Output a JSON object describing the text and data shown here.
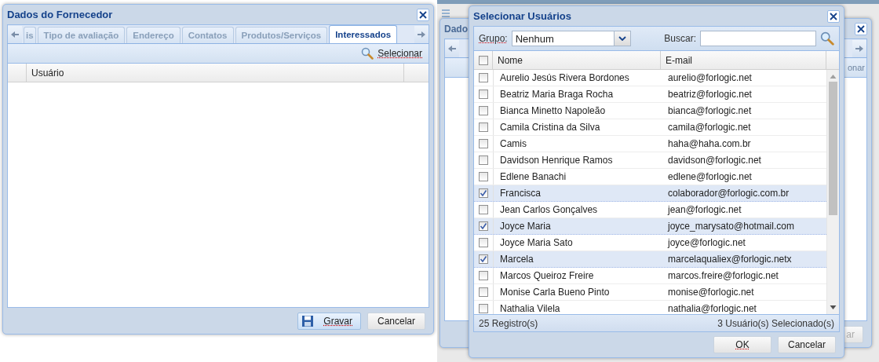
{
  "left_dialog": {
    "title": "Dados do Fornecedor",
    "tabs": [
      {
        "label": "is",
        "selected": false
      },
      {
        "label": "Tipo de avaliação",
        "selected": false
      },
      {
        "label": "Endereço",
        "selected": false
      },
      {
        "label": "Contatos",
        "selected": false
      },
      {
        "label": "Produtos/Serviços",
        "selected": false
      },
      {
        "label": "Interessados",
        "selected": true
      }
    ],
    "select_link": "Selecionar",
    "columns": [
      "Usuário"
    ],
    "buttons": [
      {
        "label": "Gravar",
        "kind": "save"
      },
      {
        "label": "Cancelar",
        "kind": "plain"
      }
    ]
  },
  "background_window": {
    "title": "Dado",
    "toolbar_text": "onar",
    "button": "ar"
  },
  "select_dialog": {
    "title": "Selecionar Usuários",
    "group_label": "Grupo:",
    "group_value": "Nenhum",
    "search_label": "Buscar:",
    "columns": [
      "Nome",
      "E-mail"
    ],
    "all_checked": false,
    "rows": [
      {
        "name": "Aurelio Jesús Rivera Bordones",
        "email": "aurelio@forlogic.net",
        "checked": false
      },
      {
        "name": "Beatriz Maria Braga Rocha",
        "email": "beatriz@forlogic.net",
        "checked": false
      },
      {
        "name": "Bianca Minetto Napoleão",
        "email": "bianca@forlogic.net",
        "checked": false
      },
      {
        "name": "Camila Cristina da Silva",
        "email": "camila@forlogic.net",
        "checked": false
      },
      {
        "name": "Camis",
        "email": "haha@haha.com.br",
        "checked": false
      },
      {
        "name": "Davidson Henrique Ramos",
        "email": "davidson@forlogic.net",
        "checked": false
      },
      {
        "name": "Edlene Banachi",
        "email": "edlene@forlogic.net",
        "checked": false
      },
      {
        "name": "Francisca",
        "email": "colaborador@forlogic.com.br",
        "checked": true
      },
      {
        "name": "Jean Carlos Gonçalves",
        "email": "jean@forlogic.net",
        "checked": false
      },
      {
        "name": "Joyce Maria",
        "email": "joyce_marysato@hotmail.com",
        "checked": true
      },
      {
        "name": "Joyce Maria Sato",
        "email": "joyce@forlogic.net",
        "checked": false
      },
      {
        "name": "Marcela",
        "email": "marcelaqualiex@forlogic.netx",
        "checked": true
      },
      {
        "name": "Marcos Queiroz Freire",
        "email": "marcos.freire@forlogic.net",
        "checked": false
      },
      {
        "name": "Monise Carla Bueno Pinto",
        "email": "monise@forlogic.net",
        "checked": false
      },
      {
        "name": "Nathalia Vilela",
        "email": "nathalia@forlogic.net",
        "checked": false
      }
    ],
    "status_left": "25 Registro(s)",
    "status_right": "3 Usuário(s) Selecionado(s)",
    "buttons": [
      "OK",
      "Cancelar"
    ]
  }
}
